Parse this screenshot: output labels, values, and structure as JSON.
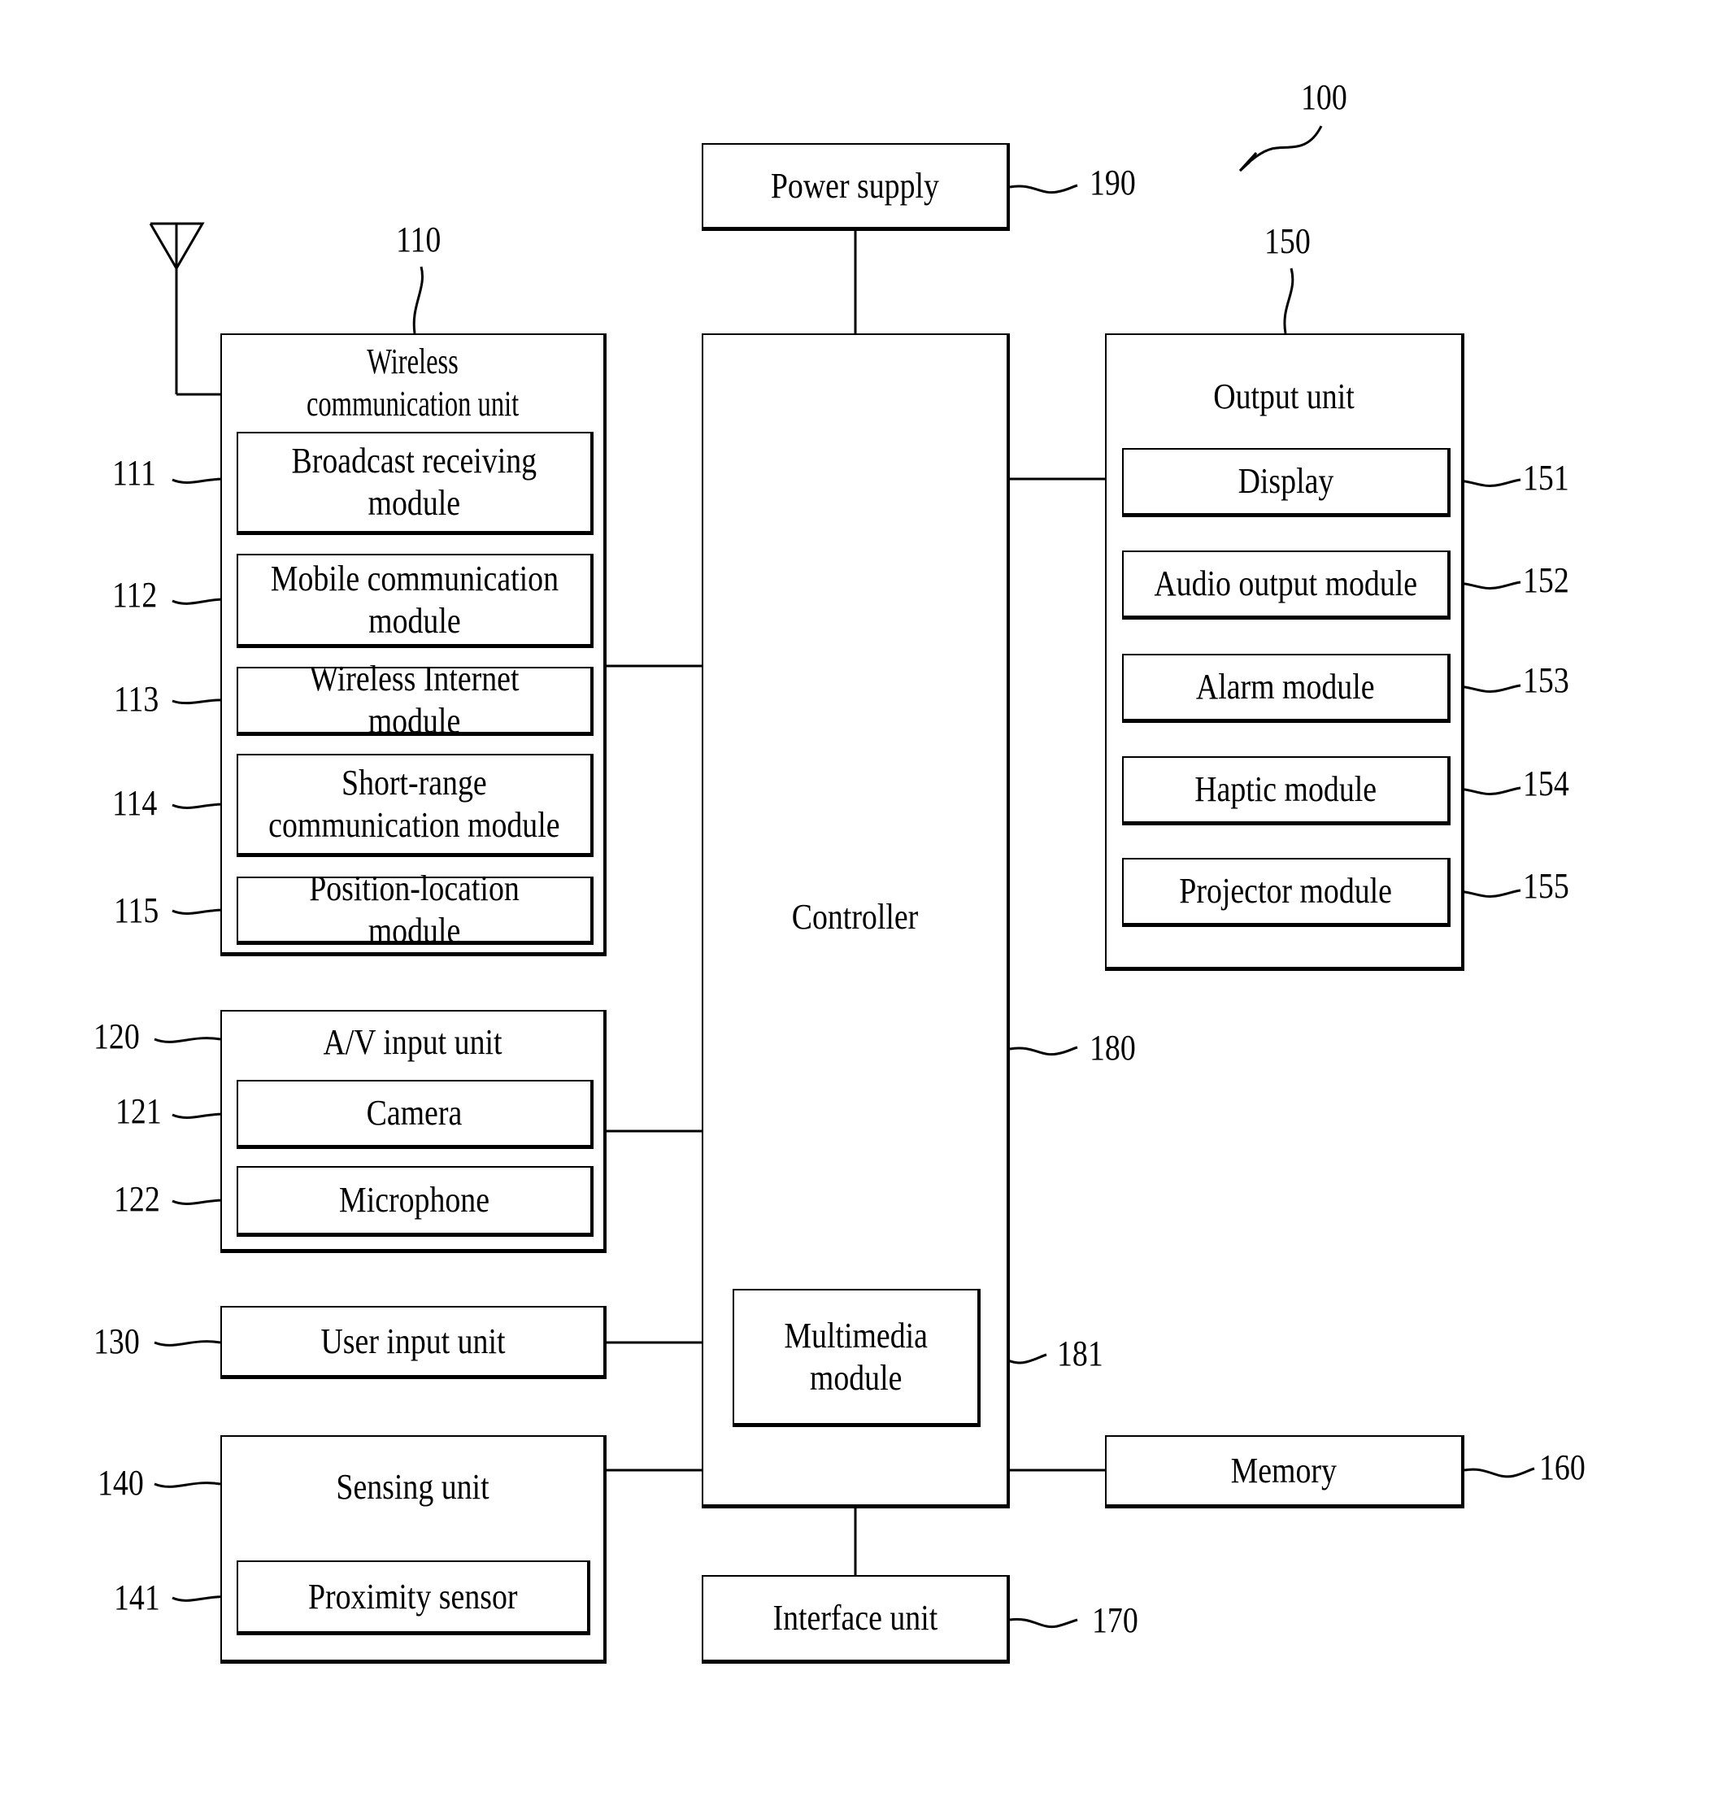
{
  "figure": {
    "ref": "100",
    "blocks": {
      "power_supply": {
        "label": "Power supply",
        "ref": "190"
      },
      "controller": {
        "label": "Controller",
        "ref": "180"
      },
      "multimedia": {
        "label": "Multimedia\nmodule",
        "ref": "181"
      },
      "interface": {
        "label": "Interface unit",
        "ref": "170"
      },
      "memory": {
        "label": "Memory",
        "ref": "160"
      },
      "wireless": {
        "label": "Wireless\ncommunication unit",
        "ref": "110",
        "modules": [
          {
            "label": "Broadcast receiving\nmodule",
            "ref": "111"
          },
          {
            "label": "Mobile communication\nmodule",
            "ref": "112"
          },
          {
            "label": "Wireless Internet module",
            "ref": "113"
          },
          {
            "label": "Short-range\ncommunication module",
            "ref": "114"
          },
          {
            "label": "Position-location module",
            "ref": "115"
          }
        ]
      },
      "av_input": {
        "label": "A/V input unit",
        "ref": "120",
        "modules": [
          {
            "label": "Camera",
            "ref": "121"
          },
          {
            "label": "Microphone",
            "ref": "122"
          }
        ]
      },
      "user_input": {
        "label": "User input unit",
        "ref": "130"
      },
      "sensing": {
        "label": "Sensing unit",
        "ref": "140",
        "modules": [
          {
            "label": "Proximity sensor",
            "ref": "141"
          }
        ]
      },
      "output": {
        "label": "Output unit",
        "ref": "150",
        "modules": [
          {
            "label": "Display",
            "ref": "151"
          },
          {
            "label": "Audio output module",
            "ref": "152"
          },
          {
            "label": "Alarm module",
            "ref": "153"
          },
          {
            "label": "Haptic module",
            "ref": "154"
          },
          {
            "label": "Projector module",
            "ref": "155"
          }
        ]
      }
    }
  }
}
